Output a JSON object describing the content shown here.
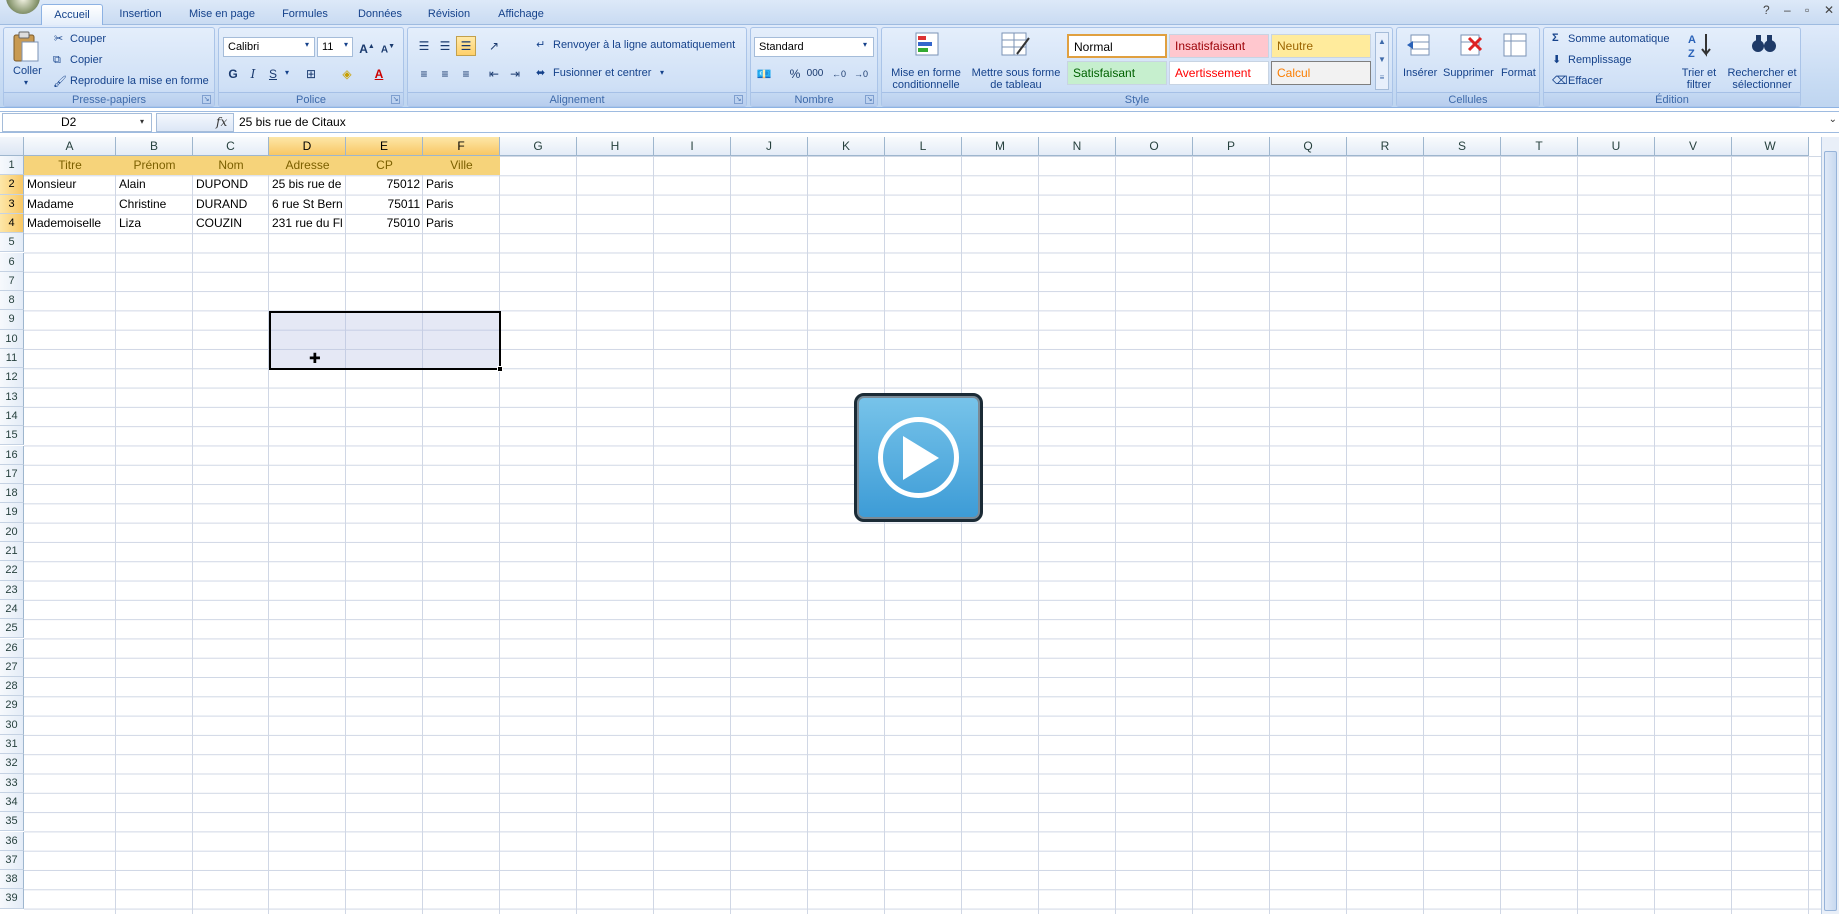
{
  "tabs": [
    {
      "label": "Accueil",
      "active": true
    },
    {
      "label": "Insertion"
    },
    {
      "label": "Mise en page"
    },
    {
      "label": "Formules"
    },
    {
      "label": "Données"
    },
    {
      "label": "Révision"
    },
    {
      "label": "Affichage"
    }
  ],
  "ribbon": {
    "clipboard": {
      "label": "Presse-papiers",
      "paste": "Coller",
      "cut": "Couper",
      "copy": "Copier",
      "format_painter": "Reproduire la mise en forme"
    },
    "font": {
      "label": "Police",
      "name": "Calibri",
      "size": "11",
      "bold": "G",
      "italic": "I",
      "underline": "S"
    },
    "alignment": {
      "label": "Alignement",
      "wrap": "Renvoyer à la ligne automatiquement",
      "merge": "Fusionner et centrer"
    },
    "number": {
      "label": "Nombre",
      "format": "Standard",
      "percent": "%",
      "thousands": "000"
    },
    "style": {
      "label": "Style",
      "cond_format": "Mise en forme conditionnelle",
      "table_format": "Mettre sous forme de tableau",
      "styles": [
        {
          "name": "Normal",
          "bg": "#ffffff",
          "fg": "#000000",
          "border": "#e0a040"
        },
        {
          "name": "Insatisfaisant",
          "bg": "#ffc7ce",
          "fg": "#9c0006"
        },
        {
          "name": "Neutre",
          "bg": "#ffeb9c",
          "fg": "#9c6500"
        },
        {
          "name": "Satisfaisant",
          "bg": "#c6efce",
          "fg": "#006100"
        },
        {
          "name": "Avertissement",
          "bg": "#ffffff",
          "fg": "#ff0000"
        },
        {
          "name": "Calcul",
          "bg": "#f2f2f2",
          "fg": "#fa7d00",
          "border": "#7f7f7f"
        }
      ]
    },
    "cells": {
      "label": "Cellules",
      "insert": "Insérer",
      "delete": "Supprimer",
      "format": "Format"
    },
    "editing": {
      "label": "Édition",
      "autosum": "Somme automatique",
      "fill": "Remplissage",
      "clear": "Effacer",
      "sort": "Trier et filtrer",
      "find": "Rechercher et sélectionner"
    }
  },
  "formula_bar": {
    "name_box": "D2",
    "fx": "fx",
    "value": "25 bis rue de Citaux"
  },
  "columns": [
    "A",
    "B",
    "C",
    "D",
    "E",
    "F",
    "G",
    "H",
    "I",
    "J",
    "K",
    "L",
    "M",
    "N",
    "O",
    "P",
    "Q",
    "R",
    "S",
    "T",
    "U",
    "V",
    "W"
  ],
  "rows": [
    "1",
    "2",
    "3",
    "4",
    "5",
    "6",
    "7",
    "8",
    "9",
    "10",
    "11",
    "12",
    "13",
    "14",
    "15",
    "16",
    "17",
    "18",
    "19",
    "20",
    "21",
    "22",
    "23",
    "24",
    "25",
    "26",
    "27",
    "28",
    "29",
    "30",
    "31",
    "32",
    "33",
    "34",
    "35",
    "36",
    "37",
    "38",
    "39"
  ],
  "sheet": {
    "headers": [
      "Titre",
      "Prénom",
      "Nom",
      "Adresse",
      "CP",
      "Ville"
    ],
    "data": [
      [
        "Monsieur",
        "Alain",
        "DUPOND",
        "25 bis rue de",
        "75012",
        "Paris"
      ],
      [
        "Madame",
        "Christine",
        "DURAND",
        "6 rue St Bern",
        "75011",
        "Paris"
      ],
      [
        "Mademoiselle",
        "Liza",
        "COUZIN",
        "231 rue du Fl",
        "75010",
        "Paris"
      ]
    ]
  }
}
